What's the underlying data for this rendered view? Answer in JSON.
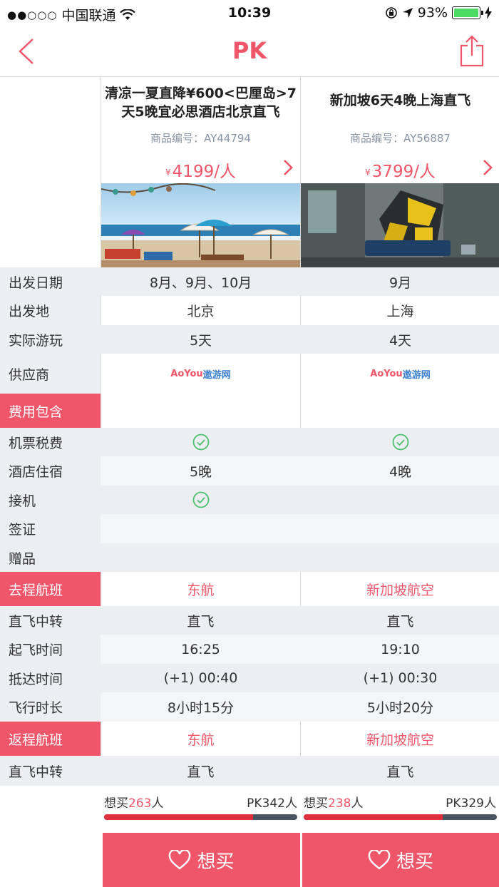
{
  "status_bar": {
    "carrier": "中国联通",
    "time": "10:39",
    "battery": "93%"
  },
  "nav": {
    "title": "PK"
  },
  "products": [
    {
      "title_line1": "清凉一夏直降¥600<巴厘岛>7",
      "title_line2": "天5晚宜必思酒店北京直飞",
      "code": "商品编号：AY44794",
      "price_symbol": "¥",
      "price": "4199/人",
      "want_prefix": "想买",
      "want_count": "263",
      "want_suffix": "人",
      "pk": "PK342人",
      "want_ratio": 0.77,
      "button_label": "想买"
    },
    {
      "title_line1": "新加坡6天4晚上海直飞",
      "title_line2": "",
      "code": "商品编号：AY56887",
      "price_symbol": "¥",
      "price": "3799/人",
      "want_prefix": "想买",
      "want_count": "238",
      "want_suffix": "人",
      "pk": "PK329人",
      "want_ratio": 0.72,
      "button_label": "想买"
    }
  ],
  "rows": {
    "departure_date": {
      "label": "出发日期",
      "v1": "8月、9月、10月",
      "v2": "9月"
    },
    "departure_place": {
      "label": "出发地",
      "v1": "北京",
      "v2": "上海"
    },
    "actual_days": {
      "label": "实际游玩",
      "v1": "5天",
      "v2": "4天"
    },
    "supplier": {
      "label": "供应商",
      "logo_a": "AoYou",
      "logo_b": "遨游网"
    },
    "fee_section": {
      "label": "费用包含"
    },
    "air_tax": {
      "label": "机票税费"
    },
    "hotel": {
      "label": "酒店住宿",
      "v1": "5晚",
      "v2": "4晚"
    },
    "pickup": {
      "label": "接机"
    },
    "visa": {
      "label": "签证"
    },
    "gift": {
      "label": "赠品"
    },
    "outbound": {
      "label": "去程航班",
      "v1": "东航",
      "v2": "新加坡航空"
    },
    "out_direct": {
      "label": "直飞中转",
      "v1": "直飞",
      "v2": "直飞"
    },
    "takeoff": {
      "label": "起飞时间",
      "v1": "16:25",
      "v2": "19:10"
    },
    "arrive": {
      "label": "抵达时间",
      "v1": "(+1) 00:40",
      "v2": "(+1) 00:30"
    },
    "duration": {
      "label": "飞行时长",
      "v1": "8小时15分",
      "v2": "5小时20分"
    },
    "return": {
      "label": "返程航班",
      "v1": "东航",
      "v2": "新加坡航空"
    },
    "ret_direct": {
      "label": "直飞中转",
      "v1": "直飞",
      "v2": "直飞"
    }
  },
  "colors": {
    "accent": "#f0566a",
    "check": "#4cc16b",
    "row_shade": "#eceef2"
  }
}
